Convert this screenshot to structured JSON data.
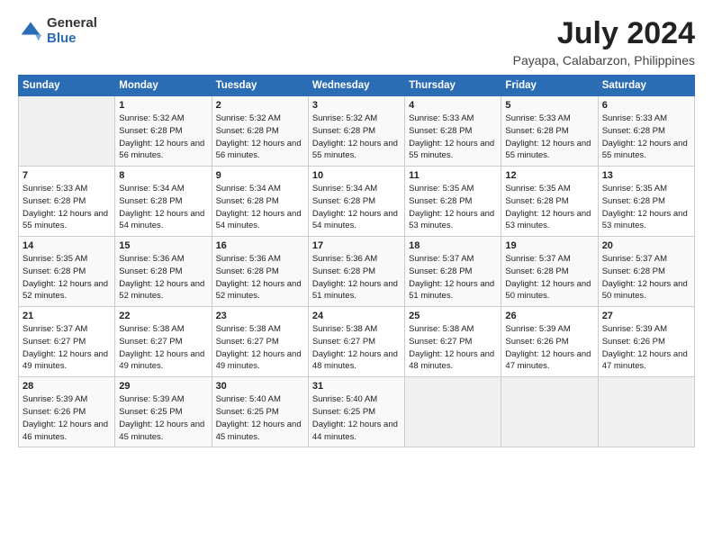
{
  "logo": {
    "general": "General",
    "blue": "Blue"
  },
  "title": "July 2024",
  "location": "Payapa, Calabarzon, Philippines",
  "days_header": [
    "Sunday",
    "Monday",
    "Tuesday",
    "Wednesday",
    "Thursday",
    "Friday",
    "Saturday"
  ],
  "weeks": [
    [
      {
        "day": "",
        "sunrise": "",
        "sunset": "",
        "daylight": ""
      },
      {
        "day": "1",
        "sunrise": "Sunrise: 5:32 AM",
        "sunset": "Sunset: 6:28 PM",
        "daylight": "Daylight: 12 hours and 56 minutes."
      },
      {
        "day": "2",
        "sunrise": "Sunrise: 5:32 AM",
        "sunset": "Sunset: 6:28 PM",
        "daylight": "Daylight: 12 hours and 56 minutes."
      },
      {
        "day": "3",
        "sunrise": "Sunrise: 5:32 AM",
        "sunset": "Sunset: 6:28 PM",
        "daylight": "Daylight: 12 hours and 55 minutes."
      },
      {
        "day": "4",
        "sunrise": "Sunrise: 5:33 AM",
        "sunset": "Sunset: 6:28 PM",
        "daylight": "Daylight: 12 hours and 55 minutes."
      },
      {
        "day": "5",
        "sunrise": "Sunrise: 5:33 AM",
        "sunset": "Sunset: 6:28 PM",
        "daylight": "Daylight: 12 hours and 55 minutes."
      },
      {
        "day": "6",
        "sunrise": "Sunrise: 5:33 AM",
        "sunset": "Sunset: 6:28 PM",
        "daylight": "Daylight: 12 hours and 55 minutes."
      }
    ],
    [
      {
        "day": "7",
        "sunrise": "Sunrise: 5:33 AM",
        "sunset": "Sunset: 6:28 PM",
        "daylight": "Daylight: 12 hours and 55 minutes."
      },
      {
        "day": "8",
        "sunrise": "Sunrise: 5:34 AM",
        "sunset": "Sunset: 6:28 PM",
        "daylight": "Daylight: 12 hours and 54 minutes."
      },
      {
        "day": "9",
        "sunrise": "Sunrise: 5:34 AM",
        "sunset": "Sunset: 6:28 PM",
        "daylight": "Daylight: 12 hours and 54 minutes."
      },
      {
        "day": "10",
        "sunrise": "Sunrise: 5:34 AM",
        "sunset": "Sunset: 6:28 PM",
        "daylight": "Daylight: 12 hours and 54 minutes."
      },
      {
        "day": "11",
        "sunrise": "Sunrise: 5:35 AM",
        "sunset": "Sunset: 6:28 PM",
        "daylight": "Daylight: 12 hours and 53 minutes."
      },
      {
        "day": "12",
        "sunrise": "Sunrise: 5:35 AM",
        "sunset": "Sunset: 6:28 PM",
        "daylight": "Daylight: 12 hours and 53 minutes."
      },
      {
        "day": "13",
        "sunrise": "Sunrise: 5:35 AM",
        "sunset": "Sunset: 6:28 PM",
        "daylight": "Daylight: 12 hours and 53 minutes."
      }
    ],
    [
      {
        "day": "14",
        "sunrise": "Sunrise: 5:35 AM",
        "sunset": "Sunset: 6:28 PM",
        "daylight": "Daylight: 12 hours and 52 minutes."
      },
      {
        "day": "15",
        "sunrise": "Sunrise: 5:36 AM",
        "sunset": "Sunset: 6:28 PM",
        "daylight": "Daylight: 12 hours and 52 minutes."
      },
      {
        "day": "16",
        "sunrise": "Sunrise: 5:36 AM",
        "sunset": "Sunset: 6:28 PM",
        "daylight": "Daylight: 12 hours and 52 minutes."
      },
      {
        "day": "17",
        "sunrise": "Sunrise: 5:36 AM",
        "sunset": "Sunset: 6:28 PM",
        "daylight": "Daylight: 12 hours and 51 minutes."
      },
      {
        "day": "18",
        "sunrise": "Sunrise: 5:37 AM",
        "sunset": "Sunset: 6:28 PM",
        "daylight": "Daylight: 12 hours and 51 minutes."
      },
      {
        "day": "19",
        "sunrise": "Sunrise: 5:37 AM",
        "sunset": "Sunset: 6:28 PM",
        "daylight": "Daylight: 12 hours and 50 minutes."
      },
      {
        "day": "20",
        "sunrise": "Sunrise: 5:37 AM",
        "sunset": "Sunset: 6:28 PM",
        "daylight": "Daylight: 12 hours and 50 minutes."
      }
    ],
    [
      {
        "day": "21",
        "sunrise": "Sunrise: 5:37 AM",
        "sunset": "Sunset: 6:27 PM",
        "daylight": "Daylight: 12 hours and 49 minutes."
      },
      {
        "day": "22",
        "sunrise": "Sunrise: 5:38 AM",
        "sunset": "Sunset: 6:27 PM",
        "daylight": "Daylight: 12 hours and 49 minutes."
      },
      {
        "day": "23",
        "sunrise": "Sunrise: 5:38 AM",
        "sunset": "Sunset: 6:27 PM",
        "daylight": "Daylight: 12 hours and 49 minutes."
      },
      {
        "day": "24",
        "sunrise": "Sunrise: 5:38 AM",
        "sunset": "Sunset: 6:27 PM",
        "daylight": "Daylight: 12 hours and 48 minutes."
      },
      {
        "day": "25",
        "sunrise": "Sunrise: 5:38 AM",
        "sunset": "Sunset: 6:27 PM",
        "daylight": "Daylight: 12 hours and 48 minutes."
      },
      {
        "day": "26",
        "sunrise": "Sunrise: 5:39 AM",
        "sunset": "Sunset: 6:26 PM",
        "daylight": "Daylight: 12 hours and 47 minutes."
      },
      {
        "day": "27",
        "sunrise": "Sunrise: 5:39 AM",
        "sunset": "Sunset: 6:26 PM",
        "daylight": "Daylight: 12 hours and 47 minutes."
      }
    ],
    [
      {
        "day": "28",
        "sunrise": "Sunrise: 5:39 AM",
        "sunset": "Sunset: 6:26 PM",
        "daylight": "Daylight: 12 hours and 46 minutes."
      },
      {
        "day": "29",
        "sunrise": "Sunrise: 5:39 AM",
        "sunset": "Sunset: 6:25 PM",
        "daylight": "Daylight: 12 hours and 45 minutes."
      },
      {
        "day": "30",
        "sunrise": "Sunrise: 5:40 AM",
        "sunset": "Sunset: 6:25 PM",
        "daylight": "Daylight: 12 hours and 45 minutes."
      },
      {
        "day": "31",
        "sunrise": "Sunrise: 5:40 AM",
        "sunset": "Sunset: 6:25 PM",
        "daylight": "Daylight: 12 hours and 44 minutes."
      },
      {
        "day": "",
        "sunrise": "",
        "sunset": "",
        "daylight": ""
      },
      {
        "day": "",
        "sunrise": "",
        "sunset": "",
        "daylight": ""
      },
      {
        "day": "",
        "sunrise": "",
        "sunset": "",
        "daylight": ""
      }
    ]
  ]
}
